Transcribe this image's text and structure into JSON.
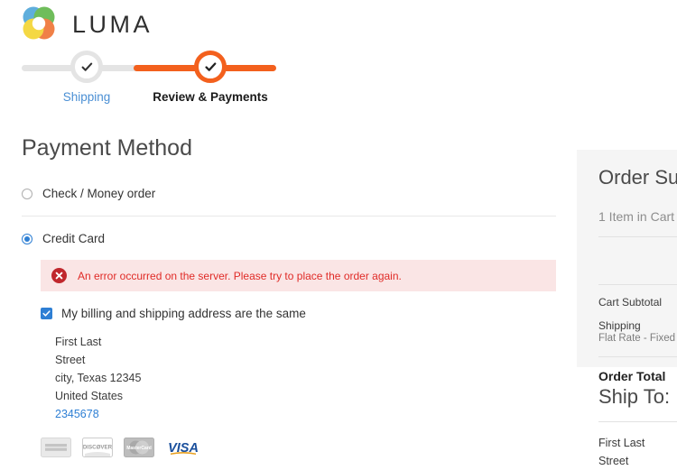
{
  "brand": {
    "name": "LUMA",
    "logo_colors": [
      "#4aa3d8",
      "#5cb545",
      "#f0a020",
      "#ef6f2e",
      "#8d6a4a",
      "#f3d32b"
    ]
  },
  "progress": {
    "steps": [
      {
        "label": "Shipping",
        "state": "complete",
        "icon": "check-icon"
      },
      {
        "label": "Review & Payments",
        "state": "active",
        "icon": "check-icon"
      }
    ],
    "colors": {
      "done": "#e4e4e4",
      "active": "#f3601d",
      "link": "#4a8fd4"
    }
  },
  "main": {
    "title": "Payment Method",
    "methods": [
      {
        "label": "Check / Money order",
        "selected": false
      },
      {
        "label": "Credit Card",
        "selected": true
      }
    ],
    "error": {
      "icon": "error-circle-icon",
      "message": "An error occurred on the server. Please try to place the order again.",
      "bg_color": "#fae5e5",
      "text_color": "#e02b27"
    },
    "billing_checkbox": {
      "label": "My billing and shipping address are the same",
      "checked": true,
      "color": "#2e7fd4"
    },
    "address": {
      "name": "First Last",
      "street": "Street",
      "city_state_zip": "city, Texas 12345",
      "country": "United States",
      "phone": "2345678"
    },
    "accepted_cards": [
      {
        "name": "american-express-card-icon",
        "label": "AMERICAN EXPRESS"
      },
      {
        "name": "discover-card-icon",
        "label": "DISCØVER"
      },
      {
        "name": "mastercard-card-icon",
        "label": "MasterCard"
      },
      {
        "name": "visa-card-icon",
        "label": "VISA"
      }
    ]
  },
  "sidebar": {
    "summary_title": "Order Summary",
    "items_in_cart": "1 Item in Cart",
    "totals": [
      {
        "label": "Cart Subtotal",
        "sub": ""
      },
      {
        "label": "Shipping",
        "sub": "Flat Rate - Fixed"
      }
    ],
    "order_total_label": "Order Total",
    "ship_to_title": "Ship To:",
    "ship_to_address": {
      "name": "First Last",
      "street": "Street"
    }
  }
}
